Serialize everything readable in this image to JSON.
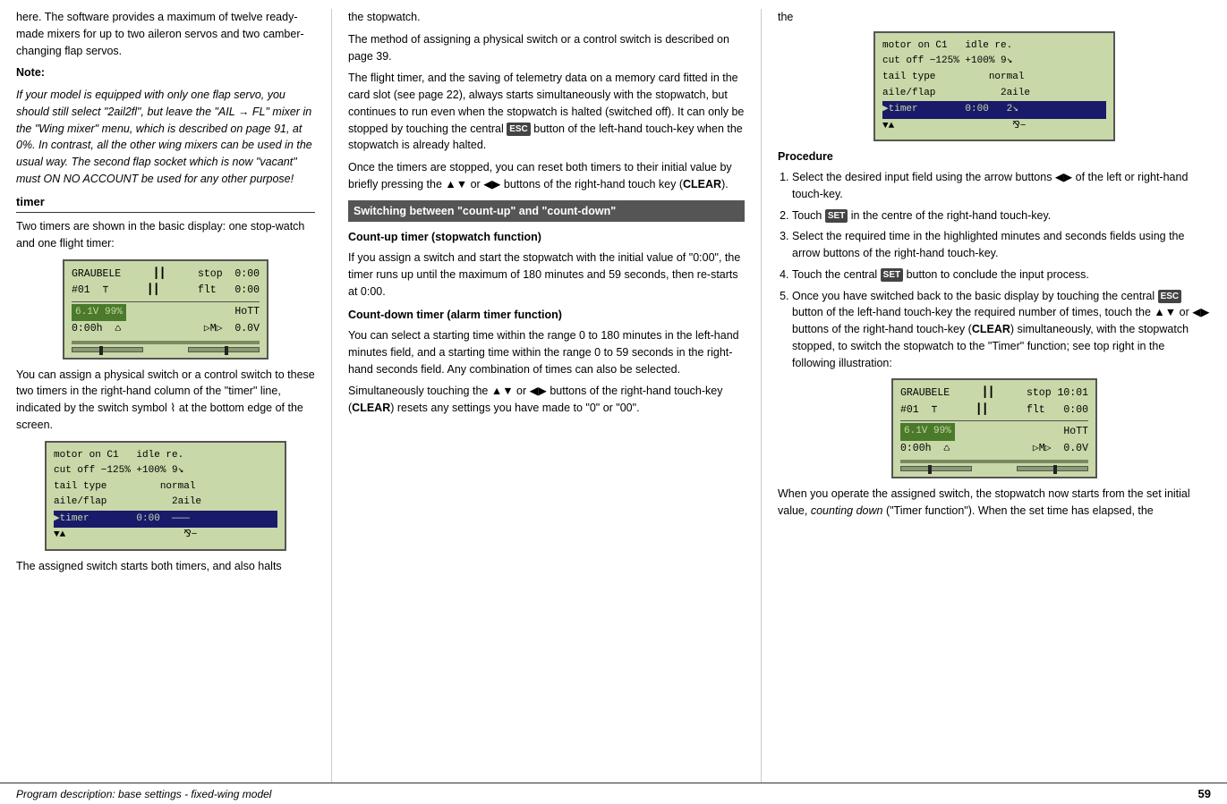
{
  "footer": {
    "label": "Program description: base settings - fixed-wing model",
    "page": "59"
  },
  "col_left": {
    "para1": "here. The software provides a maximum of twelve ready-made mixers for up to two aileron servos and two camber-changing flap servos.",
    "note_title": "Note:",
    "note_body": "If your model is equipped with only one flap servo, you should still select \"2ail2fl\", but leave the \"AIL → FL\" mixer in the \"Wing mixer\" menu, which is described on page 91, at 0%. In contrast, all the other wing mixers can be used in the usual way. The second flap socket which is now \"vacant\" must ON NO ACCOUNT be used for any other purpose!",
    "section_title": "timer",
    "para2": "Two timers are shown in the basic display: one stop-watch and one flight timer:",
    "lcd1": {
      "line1": "GRAUBELE    stop   0:00",
      "line2": "#01  ⊤      flt    0:00",
      "battery": "6.1V  99%",
      "hott": "HoTT",
      "time": "0:00h",
      "voltage": "0.0V"
    },
    "para3": "You can assign a physical switch or a control switch to these two timers in the right-hand column of the \"timer\" line, indicated by the switch symbol ⌇ at the bottom edge of the screen.",
    "lcd2": {
      "line1": "motor on C1    idle re.",
      "line2": "cut off  −125% +100% 9↘",
      "line3": "tail type          normal",
      "line4": "aile/flap            2aile",
      "timer_row": "▶timer          0:00  ———",
      "arrow_row": "▾▴                     ⌇-"
    },
    "para4": "The assigned switch starts both timers, and also halts"
  },
  "col_middle": {
    "para1": "the stopwatch.",
    "para2": "The method of assigning a physical switch or a control switch is described on page 39.",
    "para3": "The flight timer, and the saving of telemetry data on a memory card fitted in the card slot (see page 22), always starts simultaneously with the stopwatch, but continues to run even when the stopwatch is halted (switched off). It can only be stopped by touching the central ESC button of the left-hand touch-key when the stopwatch is already halted.",
    "para4": "Once the timers are stopped, you can reset both timers to their initial value by briefly pressing the ▲▼ or ◀▶ buttons of the right-hand touch key (CLEAR).",
    "section_switching": "Switching between \"count-up\" and \"count-down\"",
    "count_up_title": "Count-up timer (stopwatch function)",
    "count_up_body": "If you assign a switch and start the stopwatch with the initial value of \"0:00\", the timer runs up until the maximum of 180 minutes and 59 seconds, then re-starts at 0:00.",
    "count_down_title": "Count-down timer (alarm timer function)",
    "count_down_body": "You can select a starting time within the range 0 to 180 minutes in the left-hand minutes field, and a starting time within the range 0 to 59 seconds in the right-hand seconds field. Any combination of times can also be selected.",
    "para5": "Simultaneously touching the ▲▼ or ◀▶ buttons of the right-hand touch-key (CLEAR) resets any settings you have made to \"0\" or \"00\"."
  },
  "col_right": {
    "para1": "the",
    "lcd_top": {
      "line1": "motor on C1    idle re.",
      "line2": "cut off  −125% +100% 9↘",
      "line3": "tail type          normal",
      "line4": "aile/flap            2aile",
      "timer_row": "▶timer          0:00   2↘",
      "arrow_row": "▾▴                     ⌇-"
    },
    "procedure_title": "Procedure",
    "procedure_items": [
      "Select the desired input field using the arrow buttons ◀▶ of the left or right-hand touch-key.",
      "Touch SET in the centre of the right-hand touch-key.",
      "Select the required time in the highlighted minutes and seconds fields using the arrow buttons of the right-hand touch-key.",
      "Touch the central SET button to conclude the input process.",
      "Once you have switched back to the basic display by touching the central ESC button of the left-hand touch-key the required number of times, touch the ▲▼ or ◀▶ buttons of the right-hand touch-key (CLEAR) simultaneously, with the stopwatch stopped, to switch the stopwatch to the \"Timer\" function; see top right in the following illustration:"
    ],
    "lcd_bottom": {
      "line1": "GRAUBELE    stop  10:01",
      "line2": "#01  ⊤      flt    0:00",
      "battery": "6.1V  99%",
      "hott": "HoTT",
      "time": "0:00h",
      "voltage": "0.0V"
    },
    "para2": "When you operate the assigned switch, the stopwatch now starts from the set initial value, counting down (\"Timer function\"). When the set time has elapsed, the"
  }
}
